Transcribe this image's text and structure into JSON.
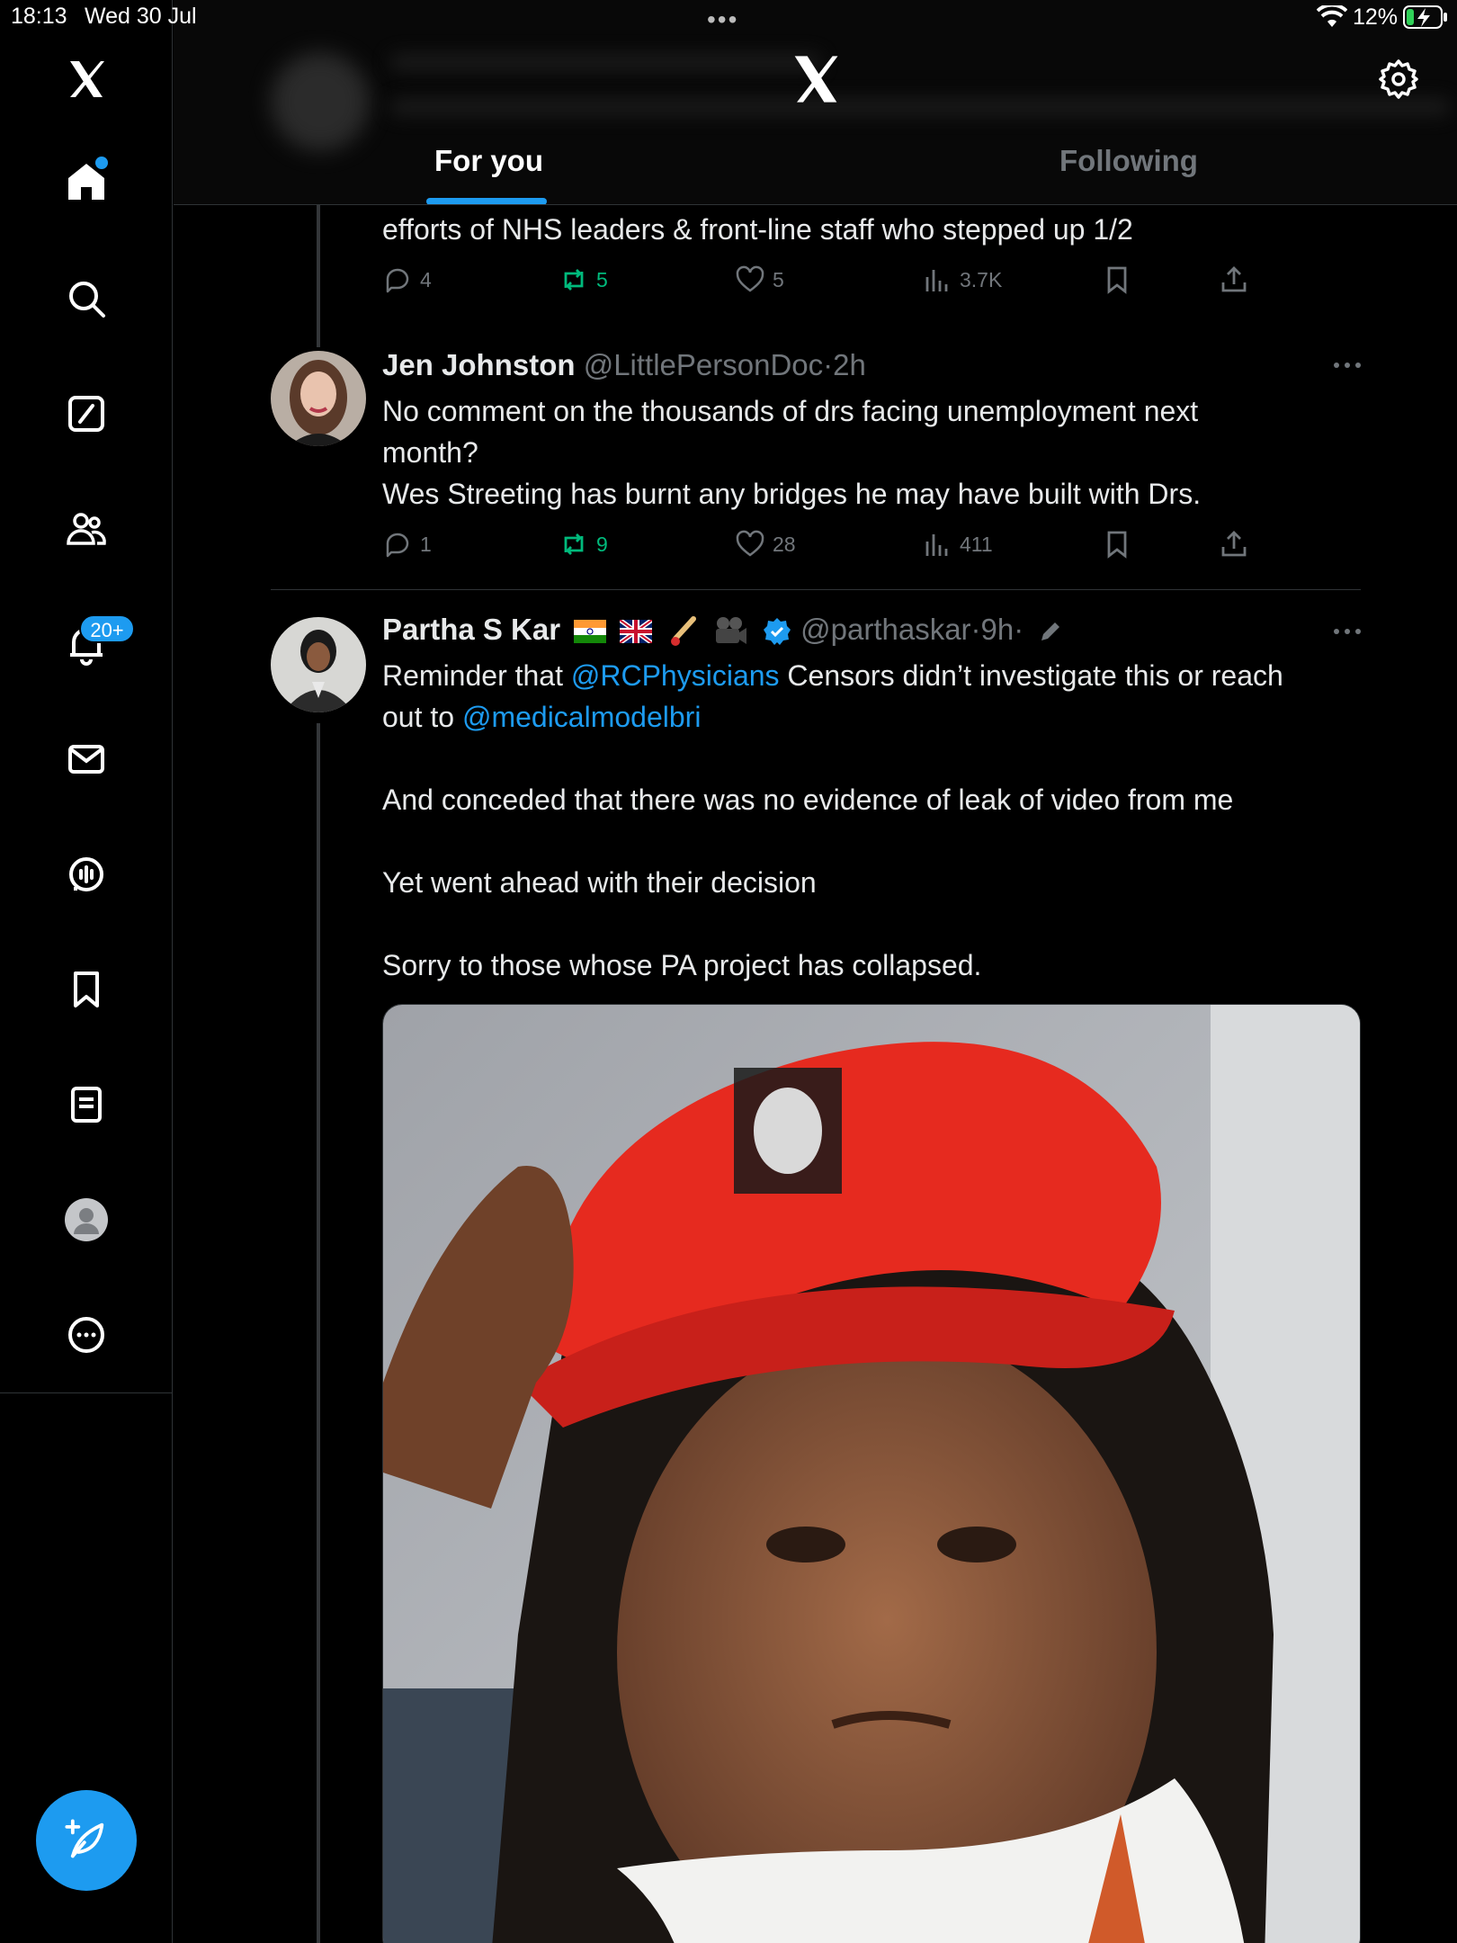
{
  "status_bar": {
    "time": "18:13",
    "date": "Wed 30 Jul",
    "battery": "12%"
  },
  "header": {
    "tabs": [
      {
        "label": "For you"
      },
      {
        "label": "Following"
      }
    ]
  },
  "sidebar": {
    "items": [
      "home",
      "explore",
      "grok",
      "communities",
      "notifications",
      "messages",
      "spaces",
      "bookmarks",
      "lists",
      "profile",
      "more"
    ],
    "notification_badge": "20+"
  },
  "feed": {
    "tweet1": {
      "text_tail": "efforts of NHS leaders & front-line staff who stepped up 1/2",
      "replies": "4",
      "reposts": "5",
      "likes": "5",
      "views": "3.7K"
    },
    "tweet2": {
      "name": "Jen Johnston",
      "handle": "@LittlePersonDoc",
      "sep": "·",
      "time": "2h",
      "lines": [
        "No comment on the thousands of drs facing unemployment next",
        "month?",
        "Wes Streeting has burnt any bridges he may have built with Drs."
      ],
      "replies": "1",
      "reposts": "9",
      "likes": "28",
      "views": "411"
    },
    "tweet3": {
      "name": "Partha S Kar",
      "handle": "@parthaskar",
      "sep": "·",
      "time": "9h",
      "sep2": "·",
      "line1_pre": "Reminder that ",
      "mention1": "@RCPhysicians",
      "line1_post": " Censors didn’t investigate this or reach",
      "line2_pre": "out to ",
      "mention2": "@medicalmodelbri",
      "line3": "And conceded that there was no evidence of leak of video from me",
      "line4": "Yet went ahead with their decision",
      "line5": "Sorry to those whose PA project has collapsed."
    }
  },
  "colors": {
    "accent": "#1d9bf0",
    "repost": "#00ba7c",
    "muted": "#71767b",
    "text": "#e7e9ea"
  }
}
